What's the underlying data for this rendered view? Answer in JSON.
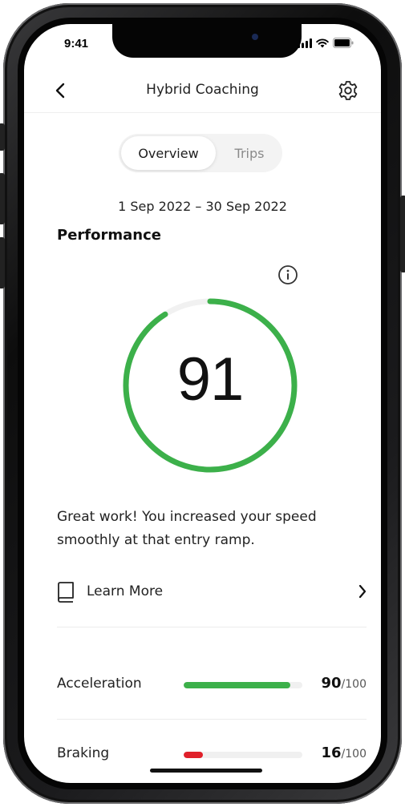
{
  "status_bar": {
    "time": "9:41"
  },
  "header": {
    "title": "Hybrid Coaching"
  },
  "segmented": {
    "active": "Overview",
    "inactive": "Trips"
  },
  "date_range": "1 Sep 2022 – 30 Sep 2022",
  "performance": {
    "title": "Performance",
    "score": "91",
    "score_fraction": 0.91,
    "message": "Great work! You increased your speed smoothly at that entry ramp."
  },
  "learn_more": {
    "label": "Learn More"
  },
  "metrics": [
    {
      "label": "Acceleration",
      "score": "90",
      "max": "/100",
      "fraction": 0.9,
      "color": "#3cb04a"
    },
    {
      "label": "Braking",
      "score": "16",
      "max": "/100",
      "fraction": 0.16,
      "color": "#e0202a"
    }
  ],
  "colors": {
    "gauge": "#3cb04a",
    "gauge_track": "#f1f1f1"
  },
  "icons": [
    "back-chevron-icon",
    "gear-icon",
    "info-icon",
    "book-icon",
    "chevron-right-icon",
    "signal-icon",
    "wifi-icon",
    "battery-icon"
  ]
}
